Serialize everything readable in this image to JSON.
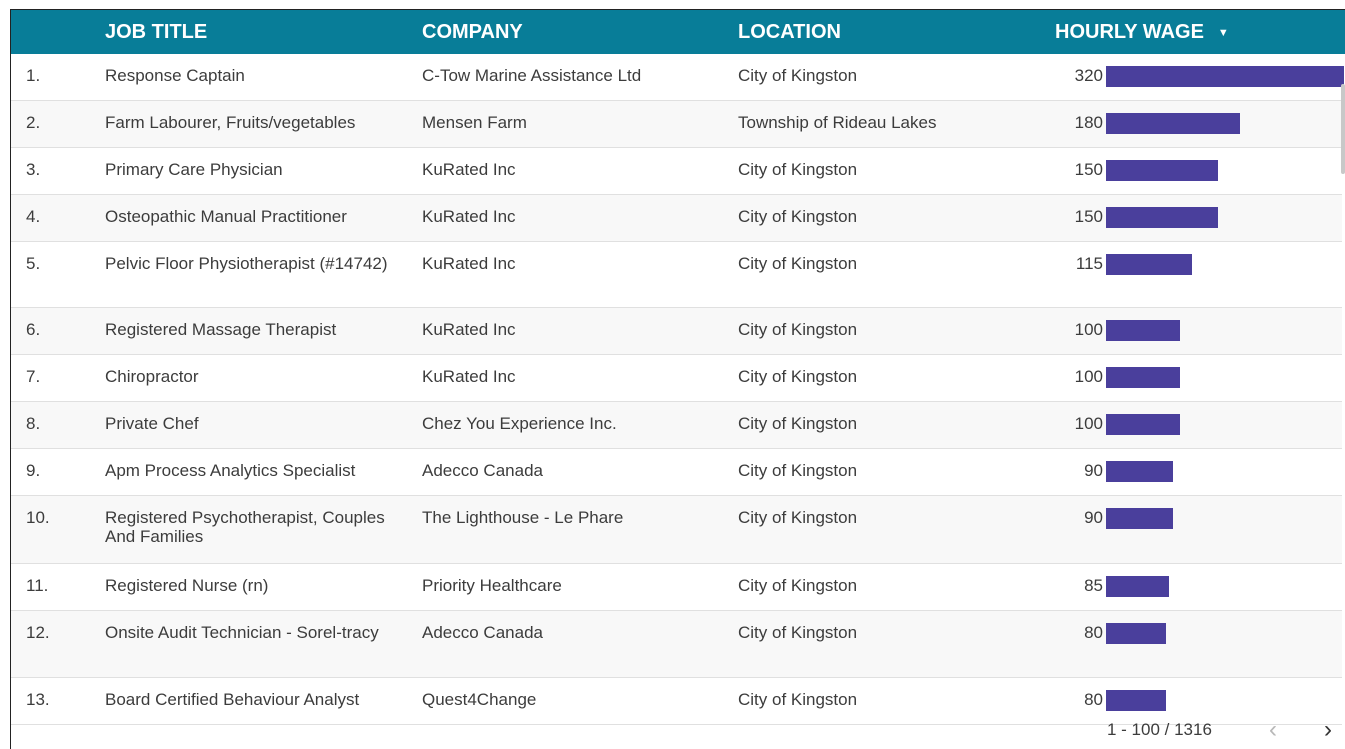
{
  "columns": {
    "job_title": "JOB TITLE",
    "company": "COMPANY",
    "location": "LOCATION",
    "hourly_wage": "HOURLY WAGE",
    "sort_icon": "caret-down-icon"
  },
  "rows": [
    {
      "num": "1.",
      "title": "Response Captain",
      "company": "C-Tow Marine Assistance Ltd",
      "location": "City of Kingston",
      "wage": 320
    },
    {
      "num": "2.",
      "title": "Farm Labourer, Fruits/vegetables",
      "company": "Mensen Farm",
      "location": "Township of Rideau Lakes",
      "wage": 180
    },
    {
      "num": "3.",
      "title": "Primary Care Physician",
      "company": "KuRated Inc",
      "location": "City of Kingston",
      "wage": 150
    },
    {
      "num": "4.",
      "title": "Osteopathic Manual Practitioner",
      "company": "KuRated Inc",
      "location": "City of Kingston",
      "wage": 150
    },
    {
      "num": "5.",
      "title": "Pelvic Floor Physiotherapist (#14742)",
      "company": "KuRated Inc",
      "location": "City of Kingston",
      "wage": 115
    },
    {
      "num": "6.",
      "title": "Registered Massage Therapist",
      "company": "KuRated Inc",
      "location": "City of Kingston",
      "wage": 100
    },
    {
      "num": "7.",
      "title": "Chiropractor",
      "company": "KuRated Inc",
      "location": "City of Kingston",
      "wage": 100
    },
    {
      "num": "8.",
      "title": "Private Chef",
      "company": "Chez You Experience Inc.",
      "location": "City of Kingston",
      "wage": 100
    },
    {
      "num": "9.",
      "title": "Apm Process Analytics Specialist",
      "company": "Adecco Canada",
      "location": "City of Kingston",
      "wage": 90
    },
    {
      "num": "10.",
      "title": "Registered Psychotherapist, Couples And Families",
      "company": "The Lighthouse - Le Phare",
      "location": "City of Kingston",
      "wage": 90
    },
    {
      "num": "11.",
      "title": "Registered Nurse (rn)",
      "company": "Priority Healthcare",
      "location": "City of Kingston",
      "wage": 85
    },
    {
      "num": "12.",
      "title": "Onsite Audit Technician - Sorel-tracy",
      "company": "Adecco Canada",
      "location": "City of Kingston",
      "wage": 80
    },
    {
      "num": "13.",
      "title": "Board Certified Behaviour Analyst",
      "company": "Quest4Change",
      "location": "City of Kingston",
      "wage": 80
    }
  ],
  "bar_max_wage": 320,
  "pagination": {
    "text": "1 - 100 / 1316",
    "prev_icon": "chevron-left-icon",
    "next_icon": "chevron-right-icon"
  },
  "colors": {
    "header_bg": "#087d98",
    "bar": "#4a3f9c"
  }
}
